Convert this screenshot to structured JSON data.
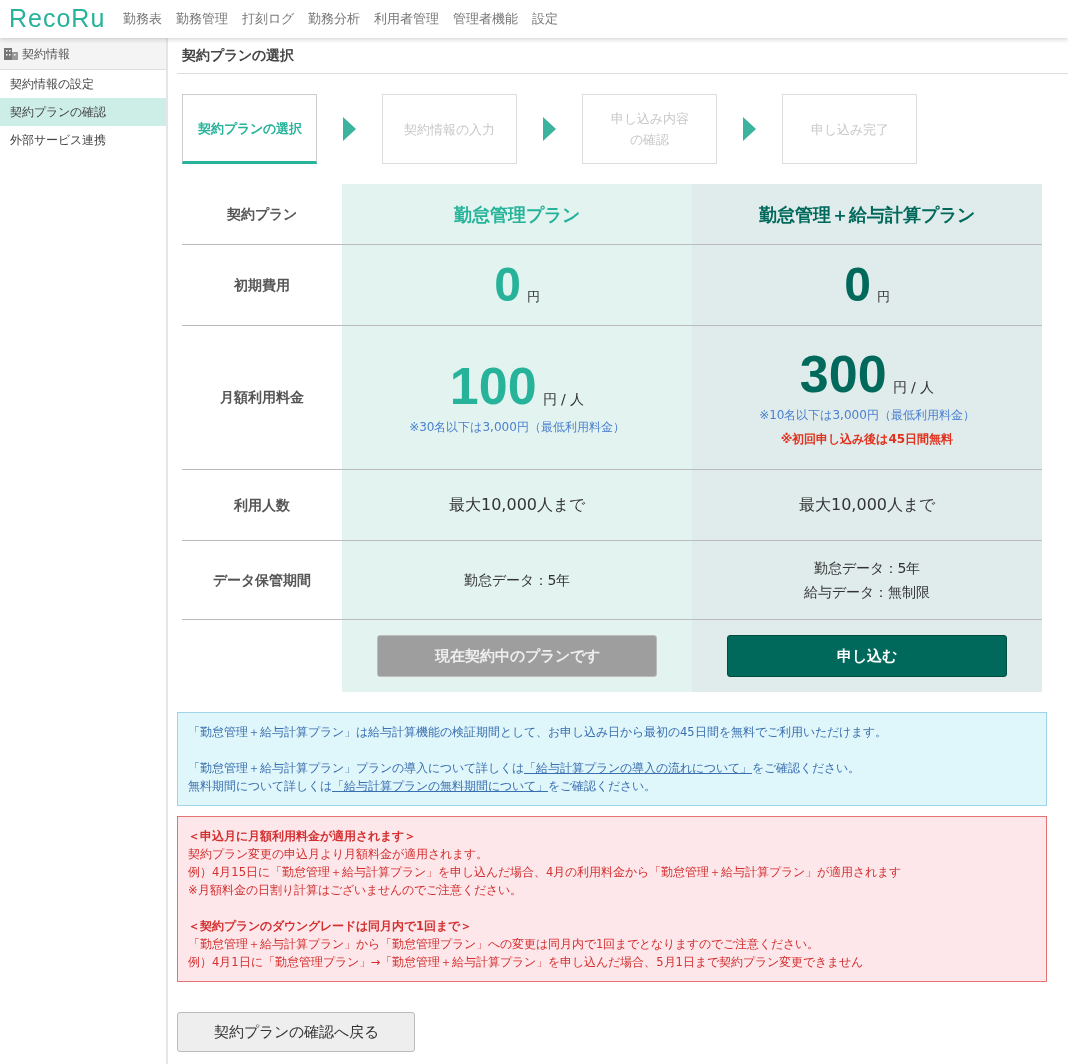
{
  "header": {
    "logo": "RecoRu",
    "nav": [
      "勤務表",
      "勤務管理",
      "打刻ログ",
      "勤務分析",
      "利用者管理",
      "管理者機能",
      "設定"
    ]
  },
  "sidebar": {
    "heading": "契約情報",
    "items": [
      {
        "label": "契約情報の設定",
        "selected": false
      },
      {
        "label": "契約プランの確認",
        "selected": true
      },
      {
        "label": "外部サービス連携",
        "selected": false
      }
    ]
  },
  "page_title": "契約プランの選択",
  "steps": [
    {
      "lines": [
        "契約プランの選択"
      ],
      "selected": true
    },
    {
      "lines": [
        "契約情報の入力"
      ],
      "selected": false
    },
    {
      "lines": [
        "申し込み内容",
        "の確認"
      ],
      "selected": false
    },
    {
      "lines": [
        "申し込み完了"
      ],
      "selected": false
    }
  ],
  "plan_table": {
    "row_labels": [
      "契約プラン",
      "初期費用",
      "月額利用料金",
      "利用人数",
      "データ保管期間"
    ],
    "plans": [
      {
        "kind": "basic",
        "color": "#26b39a",
        "name": "勤怠管理プラン",
        "initial_amount": "0",
        "initial_unit": "円",
        "monthly_amount": "100",
        "monthly_unit": "円 / 人",
        "monthly_note": "※30名以下は3,000円（最低利用料金）",
        "users": "最大10,000人まで",
        "retention": [
          "勤怠データ：5年"
        ],
        "button": {
          "label": "現在契約中のプランです",
          "disabled": true
        }
      },
      {
        "kind": "payroll",
        "color": "#00695c",
        "name": "勤怠管理＋給与計算プラン",
        "initial_amount": "0",
        "initial_unit": "円",
        "monthly_amount": "300",
        "monthly_unit": "円 / 人",
        "monthly_note": "※10名以下は3,000円（最低利用料金）",
        "promo": "※初回申し込み後は45日間無料",
        "users": "最大10,000人まで",
        "retention": [
          "勤怠データ：5年",
          "給与データ：無制限"
        ],
        "button": {
          "label": "申し込む",
          "disabled": false
        }
      }
    ]
  },
  "info_box": [
    [
      [
        {
          "text": "「勤怠管理＋給与計算プラン」は給与計算機能の検証期間として、お申し込み日から最初の45日間を無料でご利用いただけます。"
        }
      ]
    ],
    [
      [
        {
          "text": "「勤怠管理＋給与計算プラン」プランの導入について詳しくは"
        },
        {
          "text": "「給与計算プランの導入の流れについて」",
          "link": true
        },
        {
          "text": "をご確認ください。"
        }
      ],
      [
        {
          "text": "無料期間について詳しくは"
        },
        {
          "text": "「給与計算プランの無料期間について」",
          "link": true
        },
        {
          "text": "をご確認ください。"
        }
      ]
    ]
  ],
  "notice_box": [
    {
      "heading": "＜申込月に月額利用料金が適用されます＞",
      "lines": [
        "契約プラン変更の申込月より月額料金が適用されます。",
        "例）4月15日に「勤怠管理＋給与計算プラン」を申し込んだ場合、4月の利用料金から「勤怠管理＋給与計算プラン」が適用されます",
        "※月額料金の日割り計算はございませんのでご注意ください。"
      ]
    },
    {
      "heading": "＜契約プランのダウングレードは同月内で1回まで＞",
      "lines": [
        "「勤怠管理＋給与計算プラン」から「勤怠管理プラン」への変更は同月内で1回までとなりますのでご注意ください。",
        "例）4月1日に「勤怠管理プラン」→「勤怠管理＋給与計算プラン」を申し込んだ場合、5月1日まで契約プラン変更できません"
      ]
    }
  ],
  "back_button": "契約プランの確認へ戻る"
}
